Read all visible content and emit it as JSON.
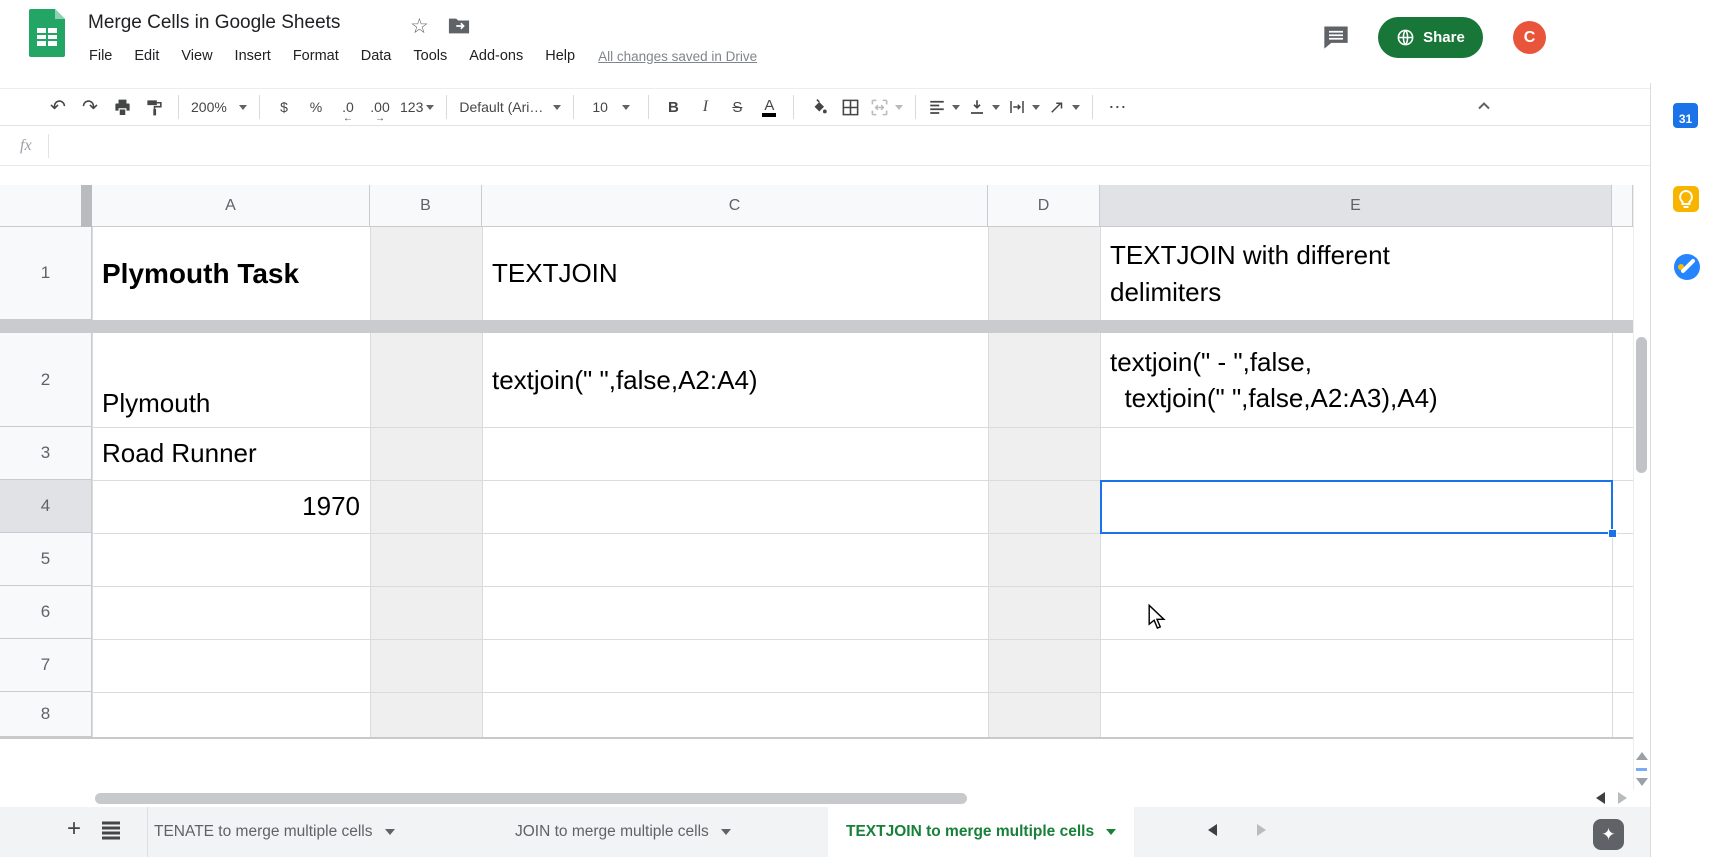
{
  "topbar": {
    "title": "Merge Cells in Google Sheets",
    "menus": [
      "File",
      "Edit",
      "View",
      "Insert",
      "Format",
      "Data",
      "Tools",
      "Add-ons",
      "Help"
    ],
    "saved_status": "All changes saved in Drive",
    "share_label": "Share",
    "avatar_letter": "C"
  },
  "toolbar": {
    "undo": "↶",
    "redo": "↷",
    "zoom": "200%",
    "currency": "$",
    "percent": "%",
    "decimal_decrease": ".0",
    "decimal_increase": ".00",
    "number_format": "123",
    "font_name": "Default (Ari…",
    "font_size": "10",
    "bold": "B",
    "italic": "I",
    "strikethrough": "S",
    "text_color": "A",
    "more": "⋯"
  },
  "formula_bar": {
    "fx_label": "fx"
  },
  "grid": {
    "column_labels": [
      "A",
      "B",
      "C",
      "D",
      "E"
    ],
    "row_labels": [
      "1",
      "2",
      "3",
      "4",
      "5",
      "6",
      "7",
      "8"
    ],
    "shaded_columns": [
      "B",
      "D"
    ],
    "frozen_after_row": "1",
    "selected_cell": "E4",
    "cells": [
      {
        "ref": "A1",
        "text": "Plymouth Task",
        "bold": true,
        "valign": "center"
      },
      {
        "ref": "C1",
        "text": "TEXTJOIN",
        "valign": "center"
      },
      {
        "ref": "E1",
        "text": "TEXTJOIN with different\ndelimiters",
        "valign": "center"
      },
      {
        "ref": "A2",
        "text": "Plymouth",
        "valign": "bottom"
      },
      {
        "ref": "C2",
        "text": "textjoin(\" \",false,A2:A4)",
        "valign": "center"
      },
      {
        "ref": "E2",
        "text": "textjoin(\" - \",false,\n  textjoin(\" \",false,A2:A3),A4)",
        "valign": "center"
      },
      {
        "ref": "A3",
        "text": "Road Runner",
        "valign": "center"
      },
      {
        "ref": "A4",
        "text": "1970",
        "align": "right",
        "valign": "center"
      }
    ]
  },
  "sheet_tabs": {
    "add_label": "+",
    "tabs": [
      {
        "label": "TENATE to merge multiple cells",
        "active": false
      },
      {
        "label": "JOIN to merge multiple cells",
        "active": false
      },
      {
        "label": "TEXTJOIN to merge multiple cells",
        "active": true
      }
    ]
  },
  "sidebar": {
    "calendar_label": "31"
  },
  "colors": {
    "selection_blue": "#1a73e8",
    "share_green": "#187638",
    "logo_green": "#23a566",
    "tab_active_green": "#188038",
    "avatar_orange": "#e8553a",
    "keep_yellow": "#f7b500",
    "tasks_blue": "#2684fc",
    "calendar_blue": "#1a73e8",
    "shaded_column": "#efefef"
  }
}
